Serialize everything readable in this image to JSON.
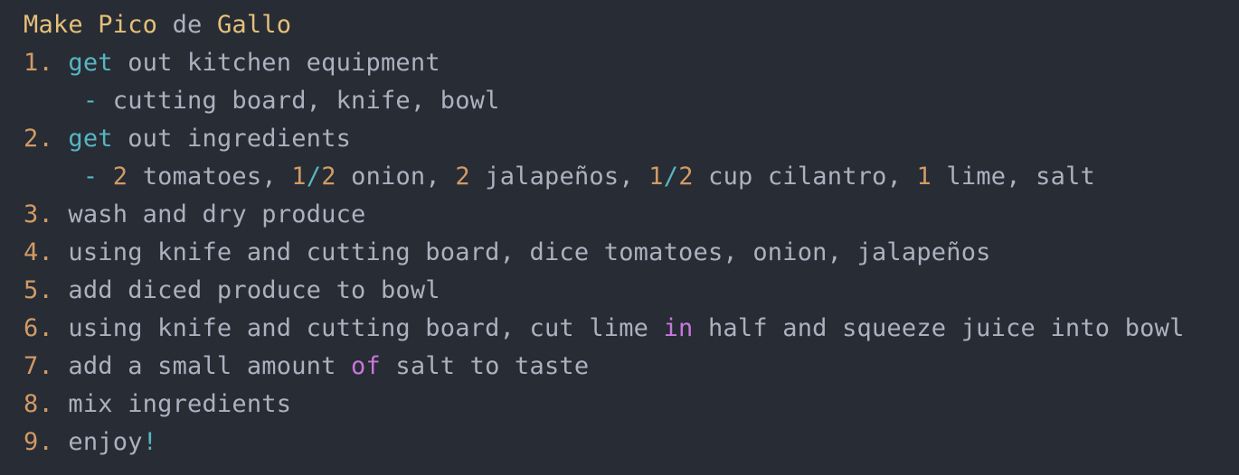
{
  "colors": {
    "background": "#282c34",
    "default": "#abb2bf",
    "yellow": "#e5c07b",
    "orange": "#d19a66",
    "cyan": "#56b6c2",
    "purple": "#c678dd"
  },
  "editor": {
    "lines": [
      [
        {
          "text": "Make Pico",
          "color": "yellow"
        },
        {
          "text": " de ",
          "color": "default"
        },
        {
          "text": "Gallo",
          "color": "yellow"
        }
      ],
      [
        {
          "text": "1. ",
          "color": "orange"
        },
        {
          "text": "get",
          "color": "cyan"
        },
        {
          "text": " out kitchen equipment",
          "color": "default"
        }
      ],
      [
        {
          "text": "    ",
          "color": "default"
        },
        {
          "text": "-",
          "color": "cyan"
        },
        {
          "text": " cutting board, knife, bowl",
          "color": "default"
        }
      ],
      [
        {
          "text": "2. ",
          "color": "orange"
        },
        {
          "text": "get",
          "color": "cyan"
        },
        {
          "text": " out ingredients",
          "color": "default"
        }
      ],
      [
        {
          "text": "    ",
          "color": "default"
        },
        {
          "text": "-",
          "color": "cyan"
        },
        {
          "text": " ",
          "color": "default"
        },
        {
          "text": "2",
          "color": "orange"
        },
        {
          "text": " tomatoes, ",
          "color": "default"
        },
        {
          "text": "1",
          "color": "orange"
        },
        {
          "text": "/",
          "color": "cyan"
        },
        {
          "text": "2",
          "color": "orange"
        },
        {
          "text": " onion, ",
          "color": "default"
        },
        {
          "text": "2",
          "color": "orange"
        },
        {
          "text": " jalapeños, ",
          "color": "default"
        },
        {
          "text": "1",
          "color": "orange"
        },
        {
          "text": "/",
          "color": "cyan"
        },
        {
          "text": "2",
          "color": "orange"
        },
        {
          "text": " cup cilantro, ",
          "color": "default"
        },
        {
          "text": "1",
          "color": "orange"
        },
        {
          "text": " lime, salt",
          "color": "default"
        }
      ],
      [
        {
          "text": "3. ",
          "color": "orange"
        },
        {
          "text": "wash and dry produce",
          "color": "default"
        }
      ],
      [
        {
          "text": "4. ",
          "color": "orange"
        },
        {
          "text": "using knife and cutting board, dice tomatoes, onion, jalapeños",
          "color": "default"
        }
      ],
      [
        {
          "text": "5. ",
          "color": "orange"
        },
        {
          "text": "add diced produce to bowl",
          "color": "default"
        }
      ],
      [
        {
          "text": "6. ",
          "color": "orange"
        },
        {
          "text": "using knife and cutting board, cut lime ",
          "color": "default"
        },
        {
          "text": "in",
          "color": "purple"
        },
        {
          "text": " half and squeeze juice into bowl",
          "color": "default"
        }
      ],
      [
        {
          "text": "7. ",
          "color": "orange"
        },
        {
          "text": "add a small amount ",
          "color": "default"
        },
        {
          "text": "of",
          "color": "purple"
        },
        {
          "text": " salt to taste",
          "color": "default"
        }
      ],
      [
        {
          "text": "8. ",
          "color": "orange"
        },
        {
          "text": "mix ingredients",
          "color": "default"
        }
      ],
      [
        {
          "text": "9. ",
          "color": "orange"
        },
        {
          "text": "enjoy",
          "color": "default"
        },
        {
          "text": "!",
          "color": "cyan"
        }
      ]
    ]
  }
}
